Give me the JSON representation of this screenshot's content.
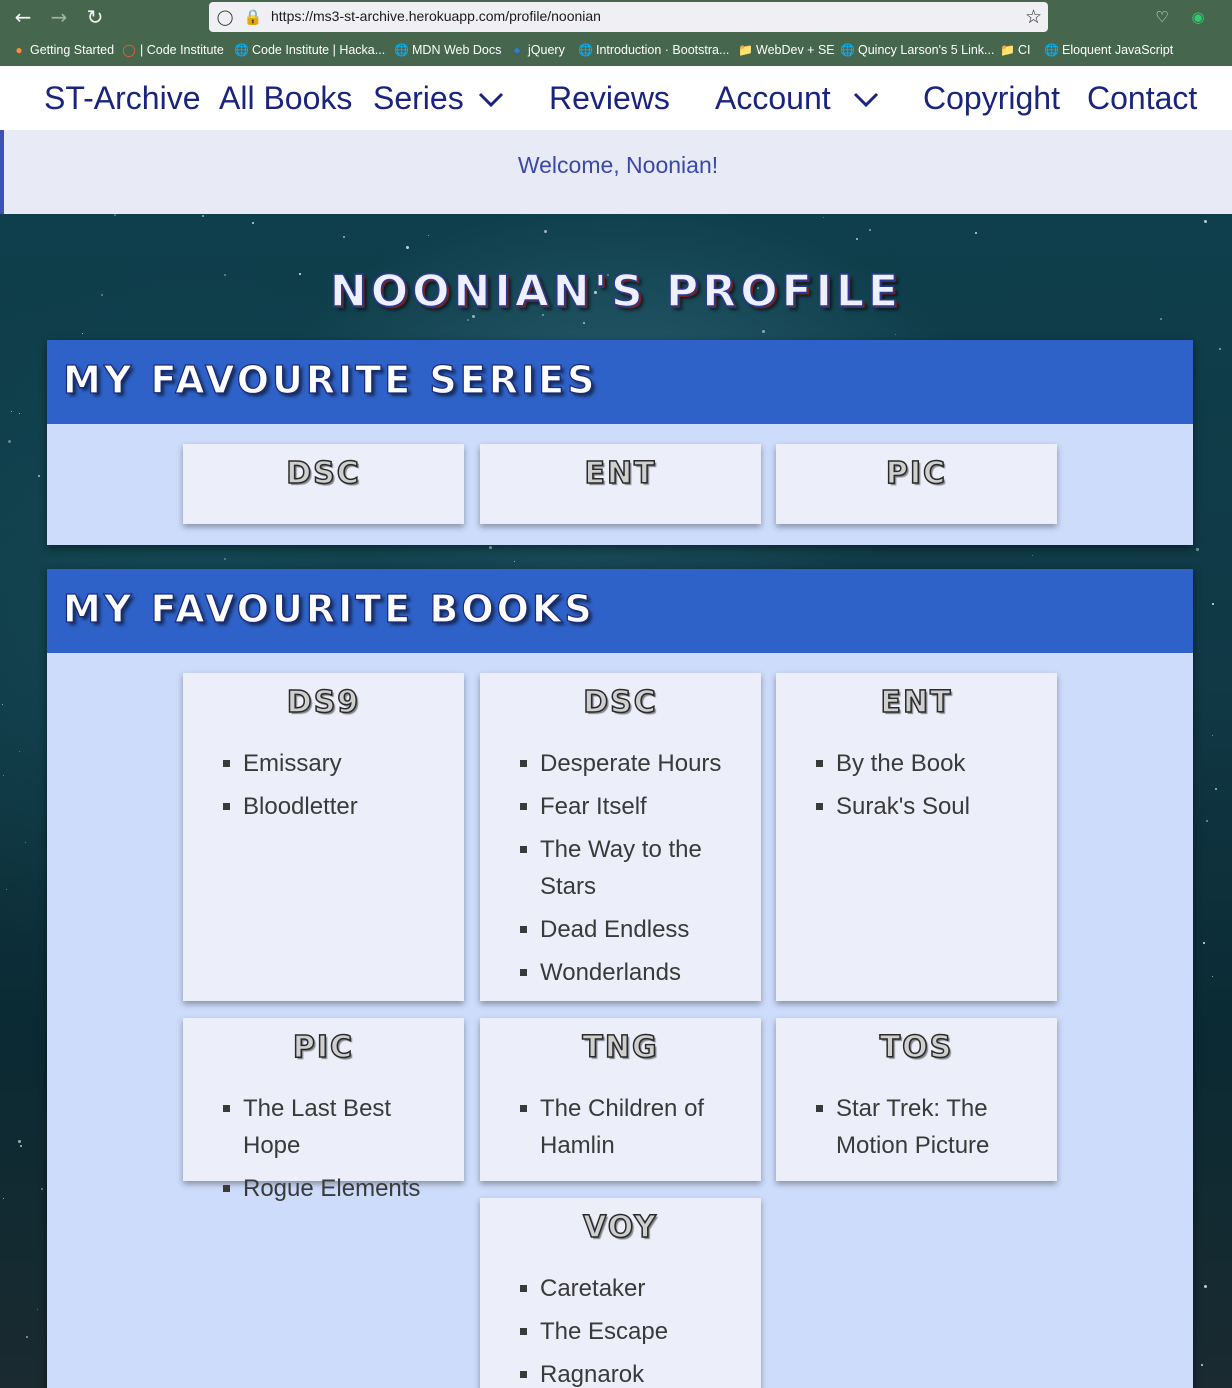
{
  "browser": {
    "url": "https://ms3-st-archive.herokuapp.com/profile/noonian",
    "bookmarks": [
      {
        "label": "Getting Started",
        "icon": "firefox-icon"
      },
      {
        "label": "| Code Institute",
        "icon": "code-institute-icon"
      },
      {
        "label": "Code Institute | Hacka...",
        "icon": "globe-icon"
      },
      {
        "label": "MDN Web Docs",
        "icon": "globe-icon"
      },
      {
        "label": "jQuery",
        "icon": "jquery-icon"
      },
      {
        "label": "Introduction · Bootstra...",
        "icon": "globe-icon"
      },
      {
        "label": "WebDev + SE",
        "icon": "folder-icon"
      },
      {
        "label": "Quincy Larson's 5 Link...",
        "icon": "globe-icon"
      },
      {
        "label": "CI",
        "icon": "folder-icon"
      },
      {
        "label": "Eloquent JavaScript",
        "icon": "globe-icon"
      }
    ]
  },
  "nav": {
    "brand": "ST-Archive",
    "all_books": "All Books",
    "series": "Series",
    "reviews": "Reviews",
    "account": "Account",
    "copyright": "Copyright",
    "contact": "Contact"
  },
  "flash": "Welcome, Noonian!",
  "profile": {
    "heading": "Noonian's Profile",
    "series_title": "My Favourite Series",
    "series": [
      "DSC",
      "ENT",
      "PIC"
    ],
    "books_title": "My Favourite Books",
    "books": [
      {
        "series": "DS9",
        "titles": [
          "Emissary",
          "Bloodletter"
        ]
      },
      {
        "series": "DSC",
        "titles": [
          "Desperate Hours",
          "Fear Itself",
          "The Way to the Stars",
          "Dead Endless",
          "Wonderlands"
        ]
      },
      {
        "series": "ENT",
        "titles": [
          "By the Book",
          "Surak's Soul"
        ]
      },
      {
        "series": "PIC",
        "titles": [
          "The Last Best Hope",
          "Rogue Elements"
        ]
      },
      {
        "series": "TNG",
        "titles": [
          "The Children of Hamlin"
        ]
      },
      {
        "series": "TOS",
        "titles": [
          "Star Trek: The Motion Picture"
        ]
      },
      {
        "series": "VOY",
        "titles": [
          "Caretaker",
          "The Escape",
          "Ragnarok"
        ]
      }
    ]
  }
}
